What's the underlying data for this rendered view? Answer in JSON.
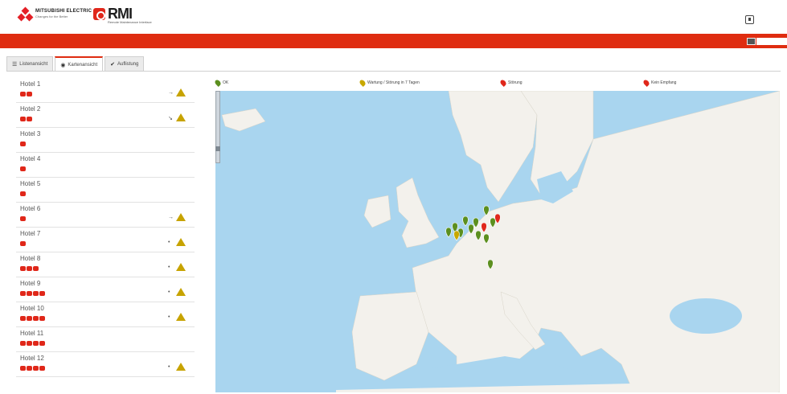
{
  "header": {
    "mitsubishi": {
      "name": "MITSUBISHI ELECTRIC",
      "tagline": "Changes for the Better"
    },
    "rmi": {
      "name": "RMI",
      "tagline": "Remote Maintenance Interface"
    },
    "user_icon": "user-box-icon"
  },
  "tabs": [
    {
      "label": "Listenansicht",
      "icon": "list-icon",
      "active": false
    },
    {
      "label": "Kartenansicht",
      "icon": "globe-icon",
      "active": true
    },
    {
      "label": "Auflistung",
      "icon": "check-icon",
      "active": false
    }
  ],
  "hotels": [
    {
      "name": "Hotel 1",
      "badges": 2,
      "arrow": "→",
      "warning": true
    },
    {
      "name": "Hotel 2",
      "badges": 2,
      "arrow": "↘",
      "warning": true
    },
    {
      "name": "Hotel 3",
      "badges": 1,
      "arrow": "",
      "warning": false
    },
    {
      "name": "Hotel 4",
      "badges": 1,
      "arrow": "",
      "warning": false
    },
    {
      "name": "Hotel 5",
      "badges": 1,
      "arrow": "",
      "warning": false
    },
    {
      "name": "Hotel 6",
      "badges": 1,
      "arrow": "→",
      "warning": true
    },
    {
      "name": "Hotel 7",
      "badges": 1,
      "arrow": "•",
      "warning": true
    },
    {
      "name": "Hotel 8",
      "badges": 3,
      "arrow": "•",
      "warning": true
    },
    {
      "name": "Hotel 9",
      "badges": 4,
      "arrow": "•",
      "warning": true
    },
    {
      "name": "Hotel 10",
      "badges": 4,
      "arrow": "•",
      "warning": true
    },
    {
      "name": "Hotel 11",
      "badges": 4,
      "arrow": "",
      "warning": false
    },
    {
      "name": "Hotel 12",
      "badges": 4,
      "arrow": "•",
      "warning": true
    }
  ],
  "legend": [
    {
      "label": "OK",
      "color": "#5c8f1f"
    },
    {
      "label": "Wartung / Störung in 7 Tagen",
      "color": "#c8a800"
    },
    {
      "label": "Störung",
      "color": "#e0271b"
    },
    {
      "label": "Kein Empfang",
      "color": "#e0271b"
    }
  ],
  "colors": {
    "brand_red": "#df2c10",
    "badge_red": "#e02719",
    "warning": "#c7a300",
    "ok_pin": "#5c8f1f",
    "sea": "#a9d5ef",
    "land": "#f3f1ec"
  }
}
